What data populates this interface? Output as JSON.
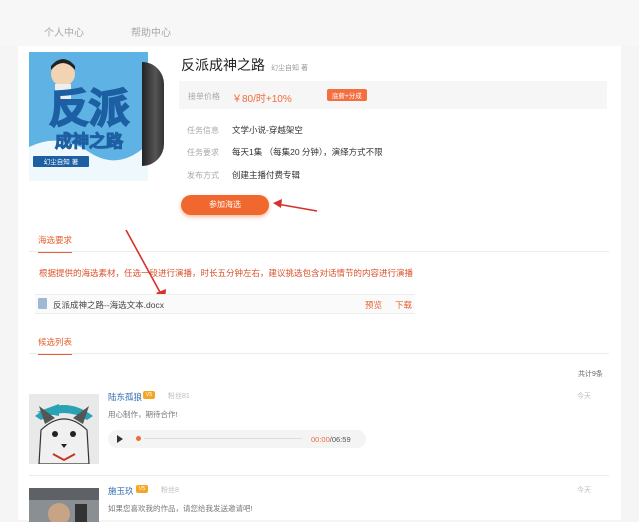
{
  "nav": {
    "items": [
      "个人中心",
      "帮助中心"
    ]
  },
  "book": {
    "cover_title_1": "反派",
    "cover_title_2": "成神之路",
    "cover_author": "幻尘自知 著",
    "title": "反派成神之路",
    "author": "幻尘自知 著"
  },
  "info": {
    "price_label": "接单价格",
    "price": "￥80/时+10%",
    "share_badge": "底薪+分成",
    "type_label": "任务信息",
    "type_value": "文学小说-穿越架空",
    "req_label": "任务要求",
    "req_value": "每天1集 （每集20 分钟），演绎方式不限",
    "publish_label": "发布方式",
    "publish_value": "创建主播付费专辑"
  },
  "join_button": "参加海选",
  "audition": {
    "tab": "海选要求",
    "text": "根据提供的海选素材，任选一段进行演播，时长五分钟左右，建议挑选包含对话情节的内容进行演播",
    "file_name": "反派成神之路--海选文本.docx",
    "preview": "预览",
    "download": "下载"
  },
  "candidates": {
    "tab": "候选列表",
    "total": "共计9条",
    "items": [
      {
        "name": "陆东孤狼",
        "badge": "V5",
        "fans": "粉丝81",
        "time": "今天",
        "message": "用心制作，期待合作!",
        "current": "00:00",
        "duration": "06:59"
      },
      {
        "name": "施玉玖",
        "badge": "V5",
        "fans": "粉丝8",
        "time": "今天",
        "message": "如果您喜欢我的作品，请您给我发送邀请吧!"
      }
    ]
  },
  "colors": {
    "accent": "#f1682f",
    "link": "#2f6bb3",
    "badge": "#f5a623"
  }
}
